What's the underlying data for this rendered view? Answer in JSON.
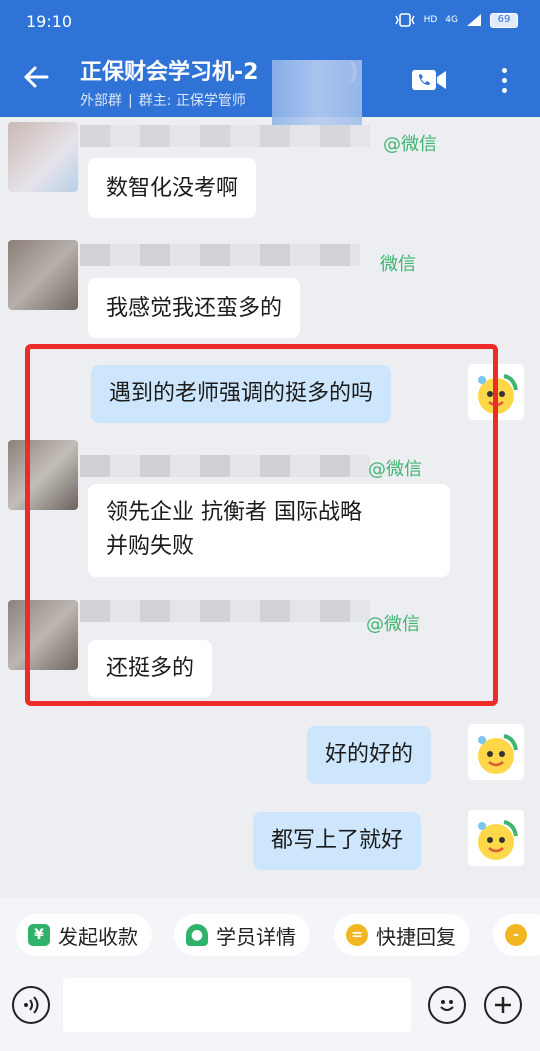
{
  "status_bar": {
    "time": "19:10",
    "signal_label": "4G",
    "hd_label": "HD",
    "battery": "69"
  },
  "header": {
    "title": "正保财会学习机-2",
    "title_suffix": ")",
    "group_type": "外部群",
    "owner_label": "群主: 正保学管师"
  },
  "messages": {
    "m1": {
      "source_tag": "@微信",
      "text": "数智化没考啊"
    },
    "m2": {
      "source_tag": "微信",
      "text": "我感觉我还蛮多的"
    },
    "m3": {
      "text": "遇到的老师强调的挺多的吗"
    },
    "m4": {
      "source_tag": "@微信",
      "line1": "领先企业 抗衡者 国际战略",
      "line2": "并购失败"
    },
    "m5": {
      "source_tag": "@微信",
      "text": "还挺多的"
    },
    "m6": {
      "text": "好的好的"
    },
    "m7": {
      "text": "都写上了就好"
    }
  },
  "quick_actions": {
    "collect_payment": "发起收款",
    "student_details": "学员详情",
    "quick_reply": "快捷回复"
  },
  "icons": {
    "back": "back-arrow-icon",
    "video": "video-call-icon",
    "more": "more-icon",
    "voice": "voice-icon",
    "emoji": "emoji-icon",
    "add": "add-icon"
  },
  "colors": {
    "brand_blue": "#2f73d6",
    "self_bubble": "#cde6fb",
    "highlight_red": "#ee2b2b",
    "wechat_green": "#3fb56f"
  }
}
